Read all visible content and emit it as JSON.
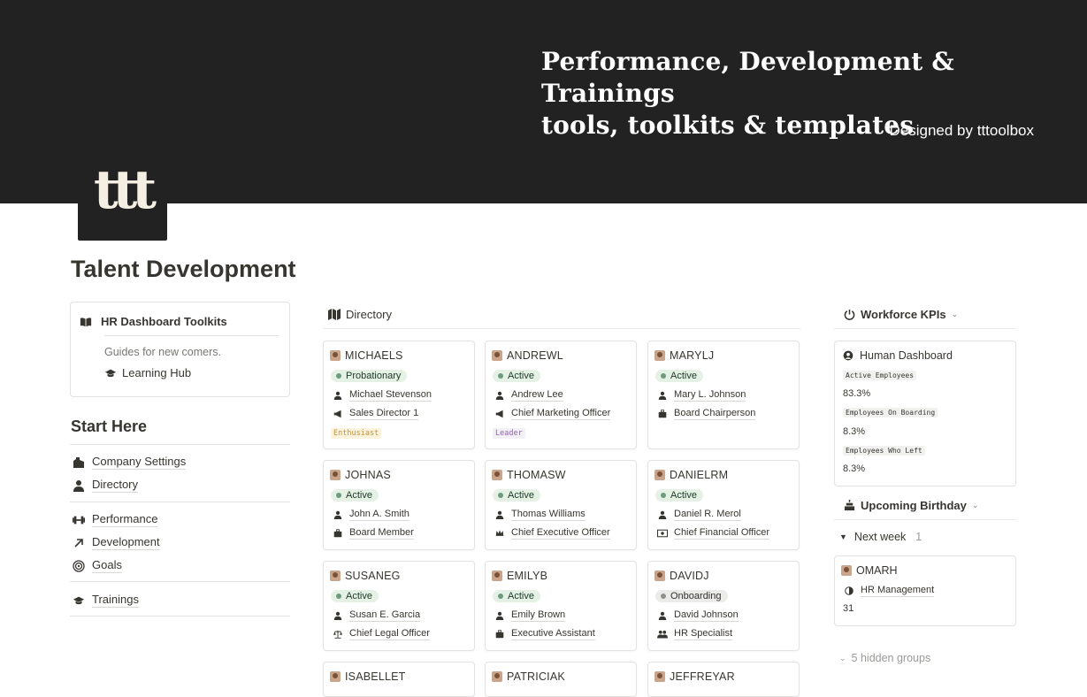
{
  "banner": {
    "title_line1": "Performance, Development & Trainings",
    "title_line2": "tools, toolkits & templates",
    "subtitle": "Designed by tttoolbox",
    "logo_text": "ttt"
  },
  "page": {
    "title": "Talent Development"
  },
  "callout": {
    "title": "HR Dashboard Toolkits",
    "guide": "Guides for new comers.",
    "link": "Learning Hub"
  },
  "start_here": {
    "heading": "Start Here",
    "items": [
      "Company Settings",
      "Directory",
      "Performance",
      "Development",
      "Goals",
      "Trainings"
    ]
  },
  "directory": {
    "title": "Directory",
    "cards": [
      {
        "code": "MICHAELS",
        "status": "Probationary",
        "name": "Michael Stevenson",
        "role": "Sales Director 1",
        "tag": "Enthusiast"
      },
      {
        "code": "ANDREWL",
        "status": "Active",
        "name": "Andrew Lee",
        "role": "Chief Marketing Officer",
        "tag": "Leader"
      },
      {
        "code": "MARYLJ",
        "status": "Active",
        "name": "Mary L. Johnson",
        "role": "Board Chairperson",
        "tag": ""
      },
      {
        "code": "JOHNAS",
        "status": "Active",
        "name": "John A. Smith",
        "role": "Board Member",
        "tag": ""
      },
      {
        "code": "THOMASW",
        "status": "Active",
        "name": "Thomas Williams",
        "role": "Chief Executive Officer",
        "tag": ""
      },
      {
        "code": "DANIELRM",
        "status": "Active",
        "name": "Daniel R. Merol",
        "role": "Chief Financial Officer",
        "tag": ""
      },
      {
        "code": "SUSANEG",
        "status": "Active",
        "name": "Susan E. Garcia",
        "role": "Chief Legal Officer",
        "tag": ""
      },
      {
        "code": "EMILYB",
        "status": "Active",
        "name": "Emily Brown",
        "role": "Executive Assistant",
        "tag": ""
      },
      {
        "code": "DAVIDJ",
        "status": "Onboarding",
        "name": "David Johnson",
        "role": "HR Specialist",
        "tag": ""
      },
      {
        "code": "ISABELLET",
        "status": "",
        "name": "",
        "role": "",
        "tag": ""
      },
      {
        "code": "PATRICIAK",
        "status": "",
        "name": "",
        "role": "",
        "tag": ""
      },
      {
        "code": "JEFFREYAR",
        "status": "",
        "name": "",
        "role": "",
        "tag": ""
      }
    ]
  },
  "kpis": {
    "title": "Workforce KPIs",
    "card_title": "Human Dashboard",
    "metrics": [
      {
        "label": "Active Employees",
        "value": "83.3%"
      },
      {
        "label": "Employees On Boarding",
        "value": "8.3%"
      },
      {
        "label": "Employees Who Left",
        "value": "8.3%"
      }
    ]
  },
  "birthday": {
    "title": "Upcoming Birthday",
    "group": "Next week",
    "group_count": "1",
    "card": {
      "code": "OMARH",
      "dept": "HR Management",
      "day": "31"
    },
    "hidden": "5 hidden groups"
  },
  "colors": {
    "banner": "#222222",
    "active_pill": "#e4f1e4",
    "onboarding_pill": "#ebebea"
  }
}
